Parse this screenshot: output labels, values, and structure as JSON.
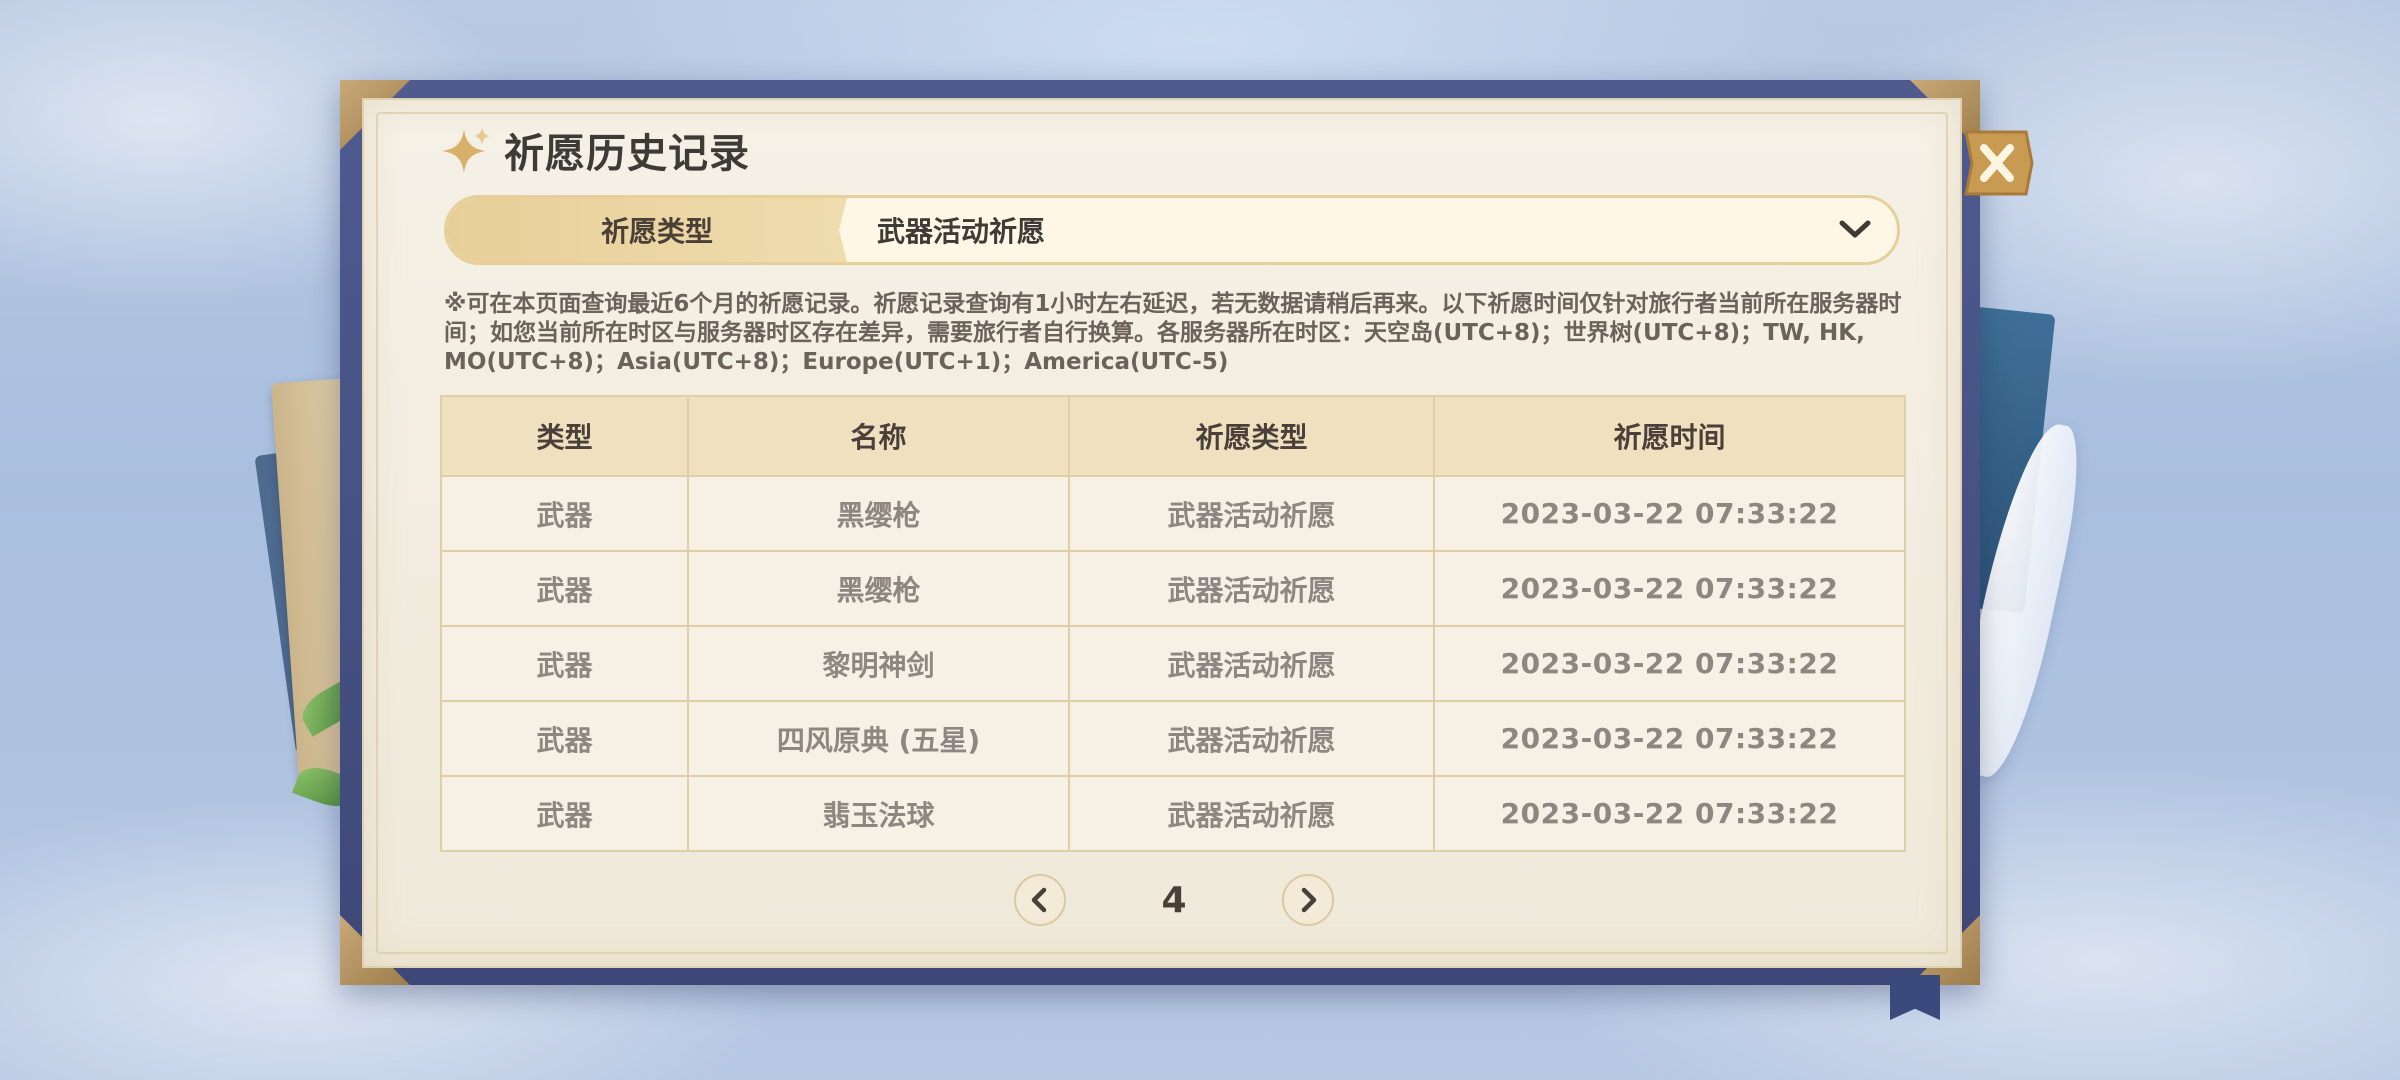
{
  "title": "祈愿历史记录",
  "filter": {
    "label": "祈愿类型",
    "selected": "武器活动祈愿"
  },
  "notice": "※可在本页面查询最近6个月的祈愿记录。祈愿记录查询有1小时左右延迟，若无数据请稍后再来。以下祈愿时间仅针对旅行者当前所在服务器时间；如您当前所在时区与服务器时区存在差异，需要旅行者自行换算。各服务器所在时区：天空岛(UTC+8)；世界树(UTC+8)；TW, HK, MO(UTC+8)；Asia(UTC+8)；Europe(UTC+1)；America(UTC-5)",
  "table": {
    "headers": [
      "类型",
      "名称",
      "祈愿类型",
      "祈愿时间"
    ],
    "rows": [
      {
        "type": "武器",
        "name": "黑缨枪",
        "wish_type": "武器活动祈愿",
        "time": "2023-03-22 07:33:22",
        "rare": false
      },
      {
        "type": "武器",
        "name": "黑缨枪",
        "wish_type": "武器活动祈愿",
        "time": "2023-03-22 07:33:22",
        "rare": false
      },
      {
        "type": "武器",
        "name": "黎明神剑",
        "wish_type": "武器活动祈愿",
        "time": "2023-03-22 07:33:22",
        "rare": false
      },
      {
        "type": "武器",
        "name": "四风原典 (五星)",
        "wish_type": "武器活动祈愿",
        "time": "2023-03-22 07:33:22",
        "rare": true
      },
      {
        "type": "武器",
        "name": "翡玉法球",
        "wish_type": "武器活动祈愿",
        "time": "2023-03-22 07:33:22",
        "rare": false
      }
    ]
  },
  "pagination": {
    "current_page": "4"
  },
  "colors": {
    "rare_text": "#c46e2b",
    "normal_text": "#8e8680",
    "header_bg": "#efe1c0",
    "accent_gold": "#e5cf9b"
  },
  "icons": {
    "title": "sparkle-star-icon",
    "dropdown": "chevron-down-icon",
    "prev": "chevron-left-icon",
    "next": "chevron-right-icon",
    "close": "close-x-icon"
  }
}
